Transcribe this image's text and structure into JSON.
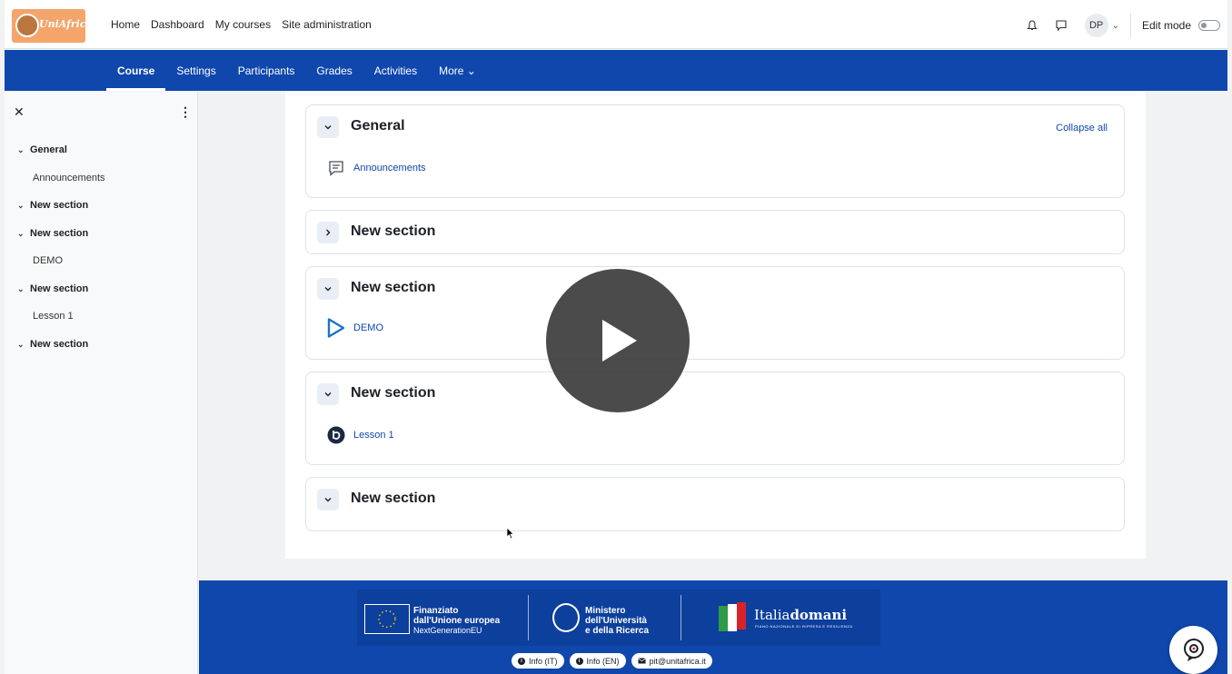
{
  "topnav": {
    "links": [
      "Home",
      "Dashboard",
      "My courses",
      "Site administration"
    ],
    "avatar_initials": "DP",
    "edit_mode_label": "Edit mode",
    "logo_text": "UniAfrica"
  },
  "secondary_nav": {
    "items": [
      "Course",
      "Settings",
      "Participants",
      "Grades",
      "Activities",
      "More ⌄"
    ],
    "active": "Course"
  },
  "course_index": {
    "items": [
      {
        "label": "General",
        "type": "section"
      },
      {
        "label": "Announcements",
        "type": "activity"
      },
      {
        "label": "New section",
        "type": "section"
      },
      {
        "label": "New section",
        "type": "section"
      },
      {
        "label": "DEMO",
        "type": "activity"
      },
      {
        "label": "New section",
        "type": "section"
      },
      {
        "label": "Lesson 1",
        "type": "activity"
      },
      {
        "label": "New section",
        "type": "section"
      }
    ]
  },
  "main": {
    "collapse_all": "Collapse all",
    "sections": [
      {
        "title": "General",
        "expanded": true,
        "activity": "Announcements",
        "activity_icon": "forum-icon"
      },
      {
        "title": "New section",
        "expanded": false
      },
      {
        "title": "New section",
        "expanded": true,
        "activity": "DEMO",
        "activity_icon": "play-outline-icon"
      },
      {
        "title": "New section",
        "expanded": true,
        "activity": "Lesson 1",
        "activity_icon": "bigbluebutton-icon"
      },
      {
        "title": "New section",
        "expanded": true
      }
    ]
  },
  "footer": {
    "eu_line1": "Finanziato",
    "eu_line2": "dall'Unione europea",
    "eu_line3": "NextGenerationEU",
    "mur_line1": "Ministero",
    "mur_line2": "dell'Università",
    "mur_line3": "e della Ricerca",
    "italia_a": "Italia",
    "italia_b": "domani",
    "italia_sub": "PIANO NAZIONALE DI RIPRESA E RESILIENZA",
    "links": [
      "Info (IT)",
      "Info (EN)",
      "pit@unitafrica.it"
    ]
  },
  "colors": {
    "brand_blue": "#0f47ad",
    "link_blue": "#0f47ad"
  }
}
